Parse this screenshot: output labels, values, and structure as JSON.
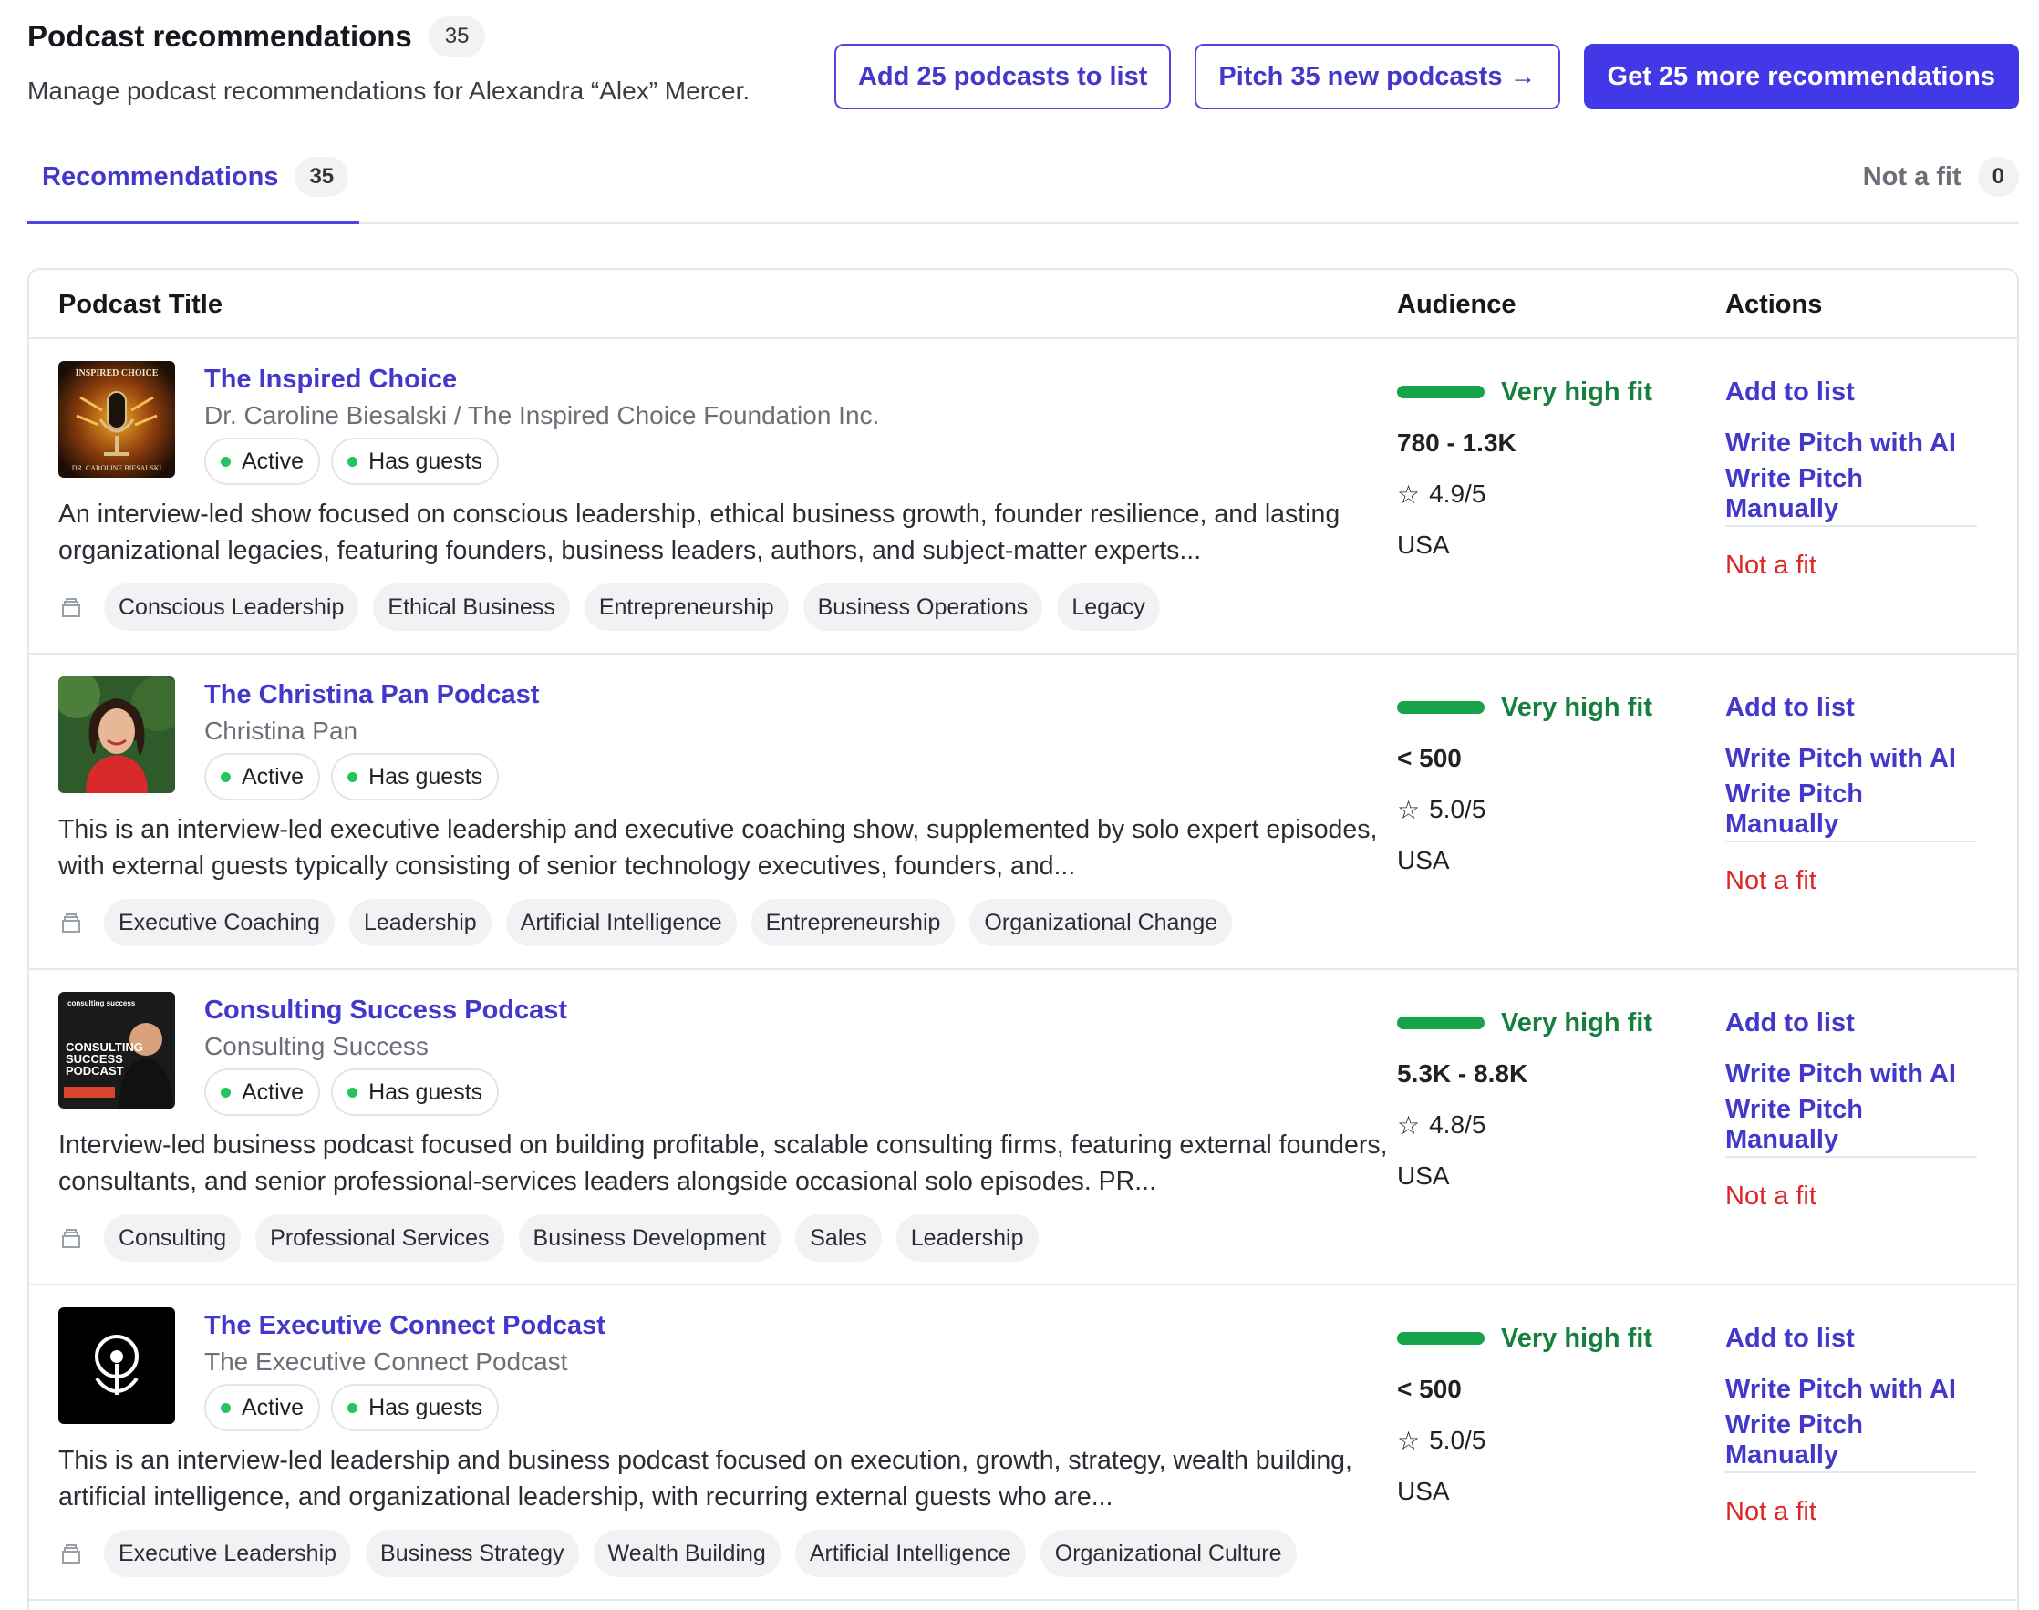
{
  "header": {
    "title": "Podcast recommendations",
    "count": "35",
    "subtitle": "Manage podcast recommendations for Alexandra “Alex” Mercer.",
    "add_button": "Add 25 podcasts to list",
    "pitch_button": "Pitch 35 new podcasts →",
    "more_button": "Get 25 more recommendations"
  },
  "tabs": {
    "recommendations_label": "Recommendations",
    "recommendations_count": "35",
    "not_fit_label": "Not a fit",
    "not_fit_count": "0"
  },
  "table": {
    "col_title": "Podcast Title",
    "col_audience": "Audience",
    "col_actions": "Actions"
  },
  "actions": {
    "add": "Add to list",
    "write_ai": "Write Pitch with AI",
    "write_manual": "Write Pitch Manually",
    "not_fit": "Not a fit"
  },
  "colors": {
    "accent": "#4338ca",
    "fit_green": "#16a34a",
    "danger": "#dc2626"
  },
  "rows": [
    {
      "title": "The Inspired Choice",
      "host": "Dr. Caroline Biesalski / The Inspired Choice Foundation Inc.",
      "status": "Active",
      "guests": "Has guests",
      "description": "An interview-led show focused on conscious leadership, ethical business growth, founder resilience, and lasting organizational legacies, featuring founders, business leaders, authors, and subject-matter experts...",
      "tags": [
        "Conscious Leadership",
        "Ethical Business",
        "Entrepreneurship",
        "Business Operations",
        "Legacy"
      ],
      "fit": "Very high fit",
      "audience": "780 - 1.3K",
      "rating": "4.9/5",
      "country": "USA",
      "art": {
        "label": "INSPIRED CHOICE",
        "footer": "DR. CAROLINE BIESALSKI",
        "icon": "microphone-icon"
      }
    },
    {
      "title": "The Christina Pan Podcast",
      "host": "Christina Pan",
      "status": "Active",
      "guests": "Has guests",
      "description": "This is an interview-led executive leadership and executive coaching show, supplemented by solo expert episodes, with external guests typically consisting of senior technology executives, founders, and...",
      "tags": [
        "Executive Coaching",
        "Leadership",
        "Artificial Intelligence",
        "Entrepreneurship",
        "Organizational Change"
      ],
      "fit": "Very high fit",
      "audience": "< 500",
      "rating": "5.0/5",
      "country": "USA",
      "art": {
        "icon": "host-portrait-icon"
      }
    },
    {
      "title": "Consulting Success Podcast",
      "host": "Consulting Success",
      "status": "Active",
      "guests": "Has guests",
      "description": "Interview-led business podcast focused on building profitable, scalable consulting firms, featuring external founders, consultants, and senior professional-services leaders alongside occasional solo episodes. PR...",
      "tags": [
        "Consulting",
        "Professional Services",
        "Business Development",
        "Sales",
        "Leadership"
      ],
      "fit": "Very high fit",
      "audience": "5.3K - 8.8K",
      "rating": "4.8/5",
      "country": "USA",
      "art": {
        "brand": "consulting success",
        "label": "CONSULTING SUCCESS PODCAST",
        "icon": "host-portrait-icon"
      }
    },
    {
      "title": "The Executive Connect Podcast",
      "host": "The Executive Connect Podcast",
      "status": "Active",
      "guests": "Has guests",
      "description": "This is an interview-led leadership and business podcast focused on execution, growth, strategy, wealth building, artificial intelligence, and organizational leadership, with recurring external guests who are...",
      "tags": [
        "Executive Leadership",
        "Business Strategy",
        "Wealth Building",
        "Artificial Intelligence",
        "Organizational Culture"
      ],
      "fit": "Very high fit",
      "audience": "< 500",
      "rating": "5.0/5",
      "country": "USA",
      "art": {
        "icon": "podcast-logo-icon"
      }
    }
  ]
}
